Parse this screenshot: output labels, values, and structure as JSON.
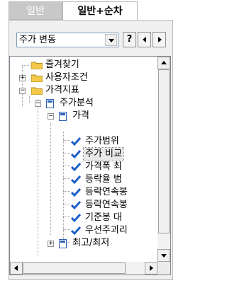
{
  "tabs": [
    {
      "label": "일반"
    },
    {
      "label": "일반+순차"
    }
  ],
  "toolbar": {
    "combo_value": "주가 변동",
    "help_label": "?"
  },
  "tree": [
    {
      "label": "즐겨찾기"
    },
    {
      "label": "사용자조건"
    },
    {
      "label": "가격지표"
    },
    {
      "label": "주가분석"
    },
    {
      "label": "가격"
    },
    {
      "label": "주가범위"
    },
    {
      "label": "주가 비교"
    },
    {
      "label": "가격폭 최"
    },
    {
      "label": "등락율 범"
    },
    {
      "label": "등락연속봉"
    },
    {
      "label": "등락연속봉"
    },
    {
      "label": "기준봉 대"
    },
    {
      "label": "우선주괴리"
    },
    {
      "label": "최고/최저"
    }
  ],
  "colors": {
    "folder": "#f3c94a",
    "doc": "#2d5fb8",
    "check": "#1a5fc8"
  }
}
